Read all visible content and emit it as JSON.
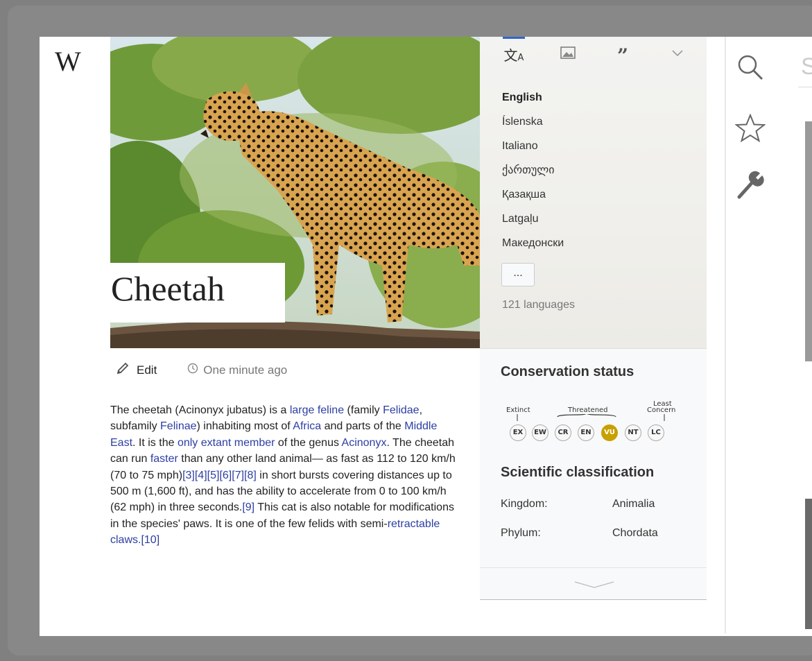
{
  "logo": "W",
  "article": {
    "title": "Cheetah",
    "edit_label": "Edit",
    "last_edited": "One minute ago",
    "paragraph": [
      {
        "t": "The cheetah (Acinonyx jubatus) is a "
      },
      {
        "t": "large feline",
        "link": true
      },
      {
        "t": " (family "
      },
      {
        "t": "Felidae",
        "link": true
      },
      {
        "t": ", subfamily "
      },
      {
        "t": "Felinae",
        "link": true
      },
      {
        "t": ") inhabiting most of "
      },
      {
        "t": "Africa",
        "link": true
      },
      {
        "t": " and parts of the "
      },
      {
        "t": "Middle East",
        "link": true
      },
      {
        "t": ". It is the "
      },
      {
        "t": "only extant member",
        "link": true
      },
      {
        "t": " of the genus "
      },
      {
        "t": "Acinonyx",
        "link": true
      },
      {
        "t": ". The cheetah can run "
      },
      {
        "t": "faster",
        "link": true
      },
      {
        "t": " than any other land animal— as fast as 112 to 120 km/h (70 to 75 mph)"
      },
      {
        "t": "[3]",
        "link": true
      },
      {
        "t": "[4]",
        "link": true
      },
      {
        "t": "[5]",
        "link": true
      },
      {
        "t": "[6]",
        "link": true
      },
      {
        "t": "[7]",
        "link": true
      },
      {
        "t": "[8]",
        "link": true
      },
      {
        "t": " in short bursts covering distances up to 500 m (1,600 ft), and has the ability to accelerate from 0 to 100 km/h (62 mph) in three seconds."
      },
      {
        "t": "[9]",
        "link": true
      },
      {
        "t": " This cat is also notable for modifications in the species' paws. It is one of the few felids with semi-"
      },
      {
        "t": "retractable claws.",
        "link": true
      },
      {
        "t": "[10]",
        "link": true
      }
    ]
  },
  "side_panel": {
    "tabs": [
      {
        "name": "languages-tab",
        "icon": "translate-icon",
        "active": true
      },
      {
        "name": "media-tab",
        "icon": "image-icon",
        "active": false
      },
      {
        "name": "quotes-tab",
        "icon": "quote-icon",
        "active": false
      },
      {
        "name": "more-tab",
        "icon": "chevron-down-icon",
        "active": false
      }
    ],
    "languages": [
      "English",
      "Íslenska",
      "Italiano",
      "ქართული",
      "Қазақша",
      "Latgaļu",
      "Македонски"
    ],
    "current_language": "English",
    "more_label": "...",
    "language_count": "121 languages",
    "conservation": {
      "title": "Conservation status",
      "label_extinct": "Extinct",
      "label_threatened": "Threatened",
      "label_least1": "Least",
      "label_least2": "Concern",
      "statuses": [
        "EX",
        "EW",
        "CR",
        "EN",
        "VU",
        "NT",
        "LC"
      ],
      "active_status": "VU",
      "active_color": "#c8a000"
    },
    "classification": {
      "title": "Scientific classification",
      "rows": [
        {
          "label": "Kingdom:",
          "value": "Animalia"
        },
        {
          "label": "Phylum:",
          "value": "Chordata"
        }
      ]
    }
  },
  "toolbar": {
    "search_icon": "search-icon",
    "star_icon": "star-icon",
    "wrench_icon": "wrench-icon",
    "search_placeholder": "S"
  },
  "colors": {
    "link": "#2c3ea2",
    "accent": "#3366cc"
  }
}
